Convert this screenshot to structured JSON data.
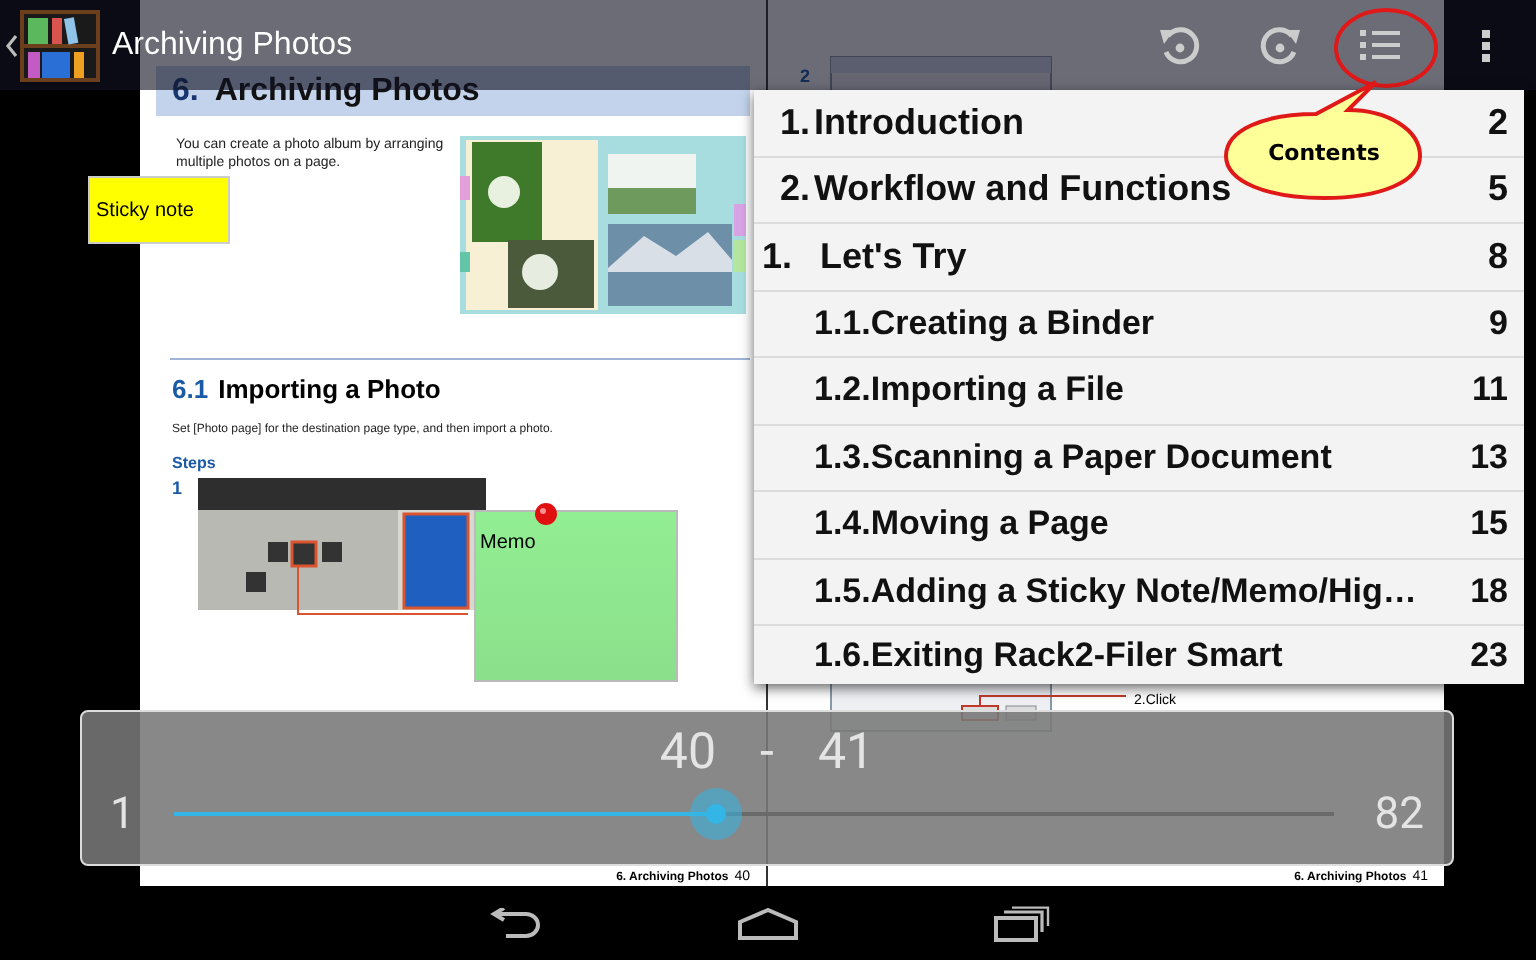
{
  "app_bar": {
    "title": "Archiving Photos"
  },
  "document": {
    "left_page": {
      "heading_number": "6.",
      "heading": "Archiving Photos",
      "intro": "You can create a photo album by arranging multiple photos on a page.",
      "section_number": "6.1",
      "section": "Importing a Photo",
      "section_text": "Set [Photo page] for the destination page type, and then import a photo.",
      "steps_label": "Steps",
      "step_number": "1",
      "footer_chapter": "6. Archiving Photos",
      "footer_page": "40"
    },
    "right_page": {
      "step_number": "2",
      "callout": "2.Click",
      "footer_chapter": "6. Archiving Photos",
      "footer_page": "41"
    }
  },
  "sticky_note": {
    "text": "Sticky note"
  },
  "memo": {
    "text": "Memo"
  },
  "contents_menu": {
    "items": [
      {
        "number": "1.",
        "title": "Introduction",
        "page": "2"
      },
      {
        "number": "2.",
        "title": "Workflow and Functions",
        "page": "5"
      },
      {
        "number": "1.",
        "title": "Let's Try",
        "page": "8",
        "children": [
          {
            "title": "1.1.Creating a Binder",
            "page": "9"
          },
          {
            "title": "1.2.Importing a File",
            "page": "11"
          },
          {
            "title": "1.3.Scanning a Paper Document",
            "page": "13"
          },
          {
            "title": "1.4.Moving a Page",
            "page": "15"
          },
          {
            "title": "1.5.Adding a Sticky Note/Memo/Hig…",
            "page": "18"
          },
          {
            "title": "1.6.Exiting Rack2-Filer Smart",
            "page": "23"
          }
        ]
      }
    ]
  },
  "annotation": {
    "text": "Contents"
  },
  "page_slider": {
    "first_page": "40",
    "separator": "-",
    "second_page": "41",
    "min": "1",
    "max": "82",
    "level": 0.467
  }
}
